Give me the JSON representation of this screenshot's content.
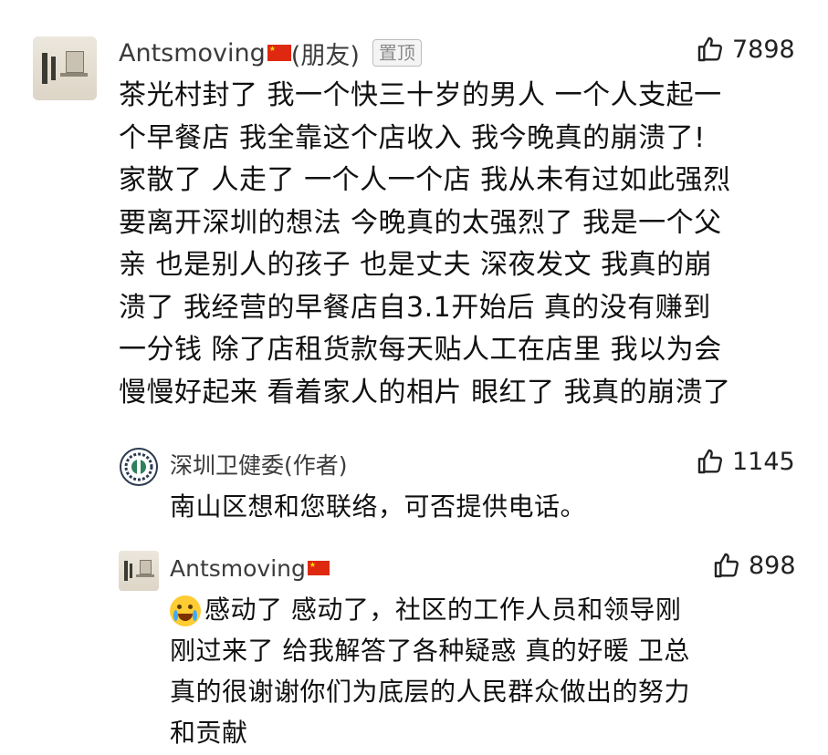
{
  "comments": [
    {
      "username": "Antsmoving",
      "relation": "(朋友)",
      "pinned_label": "置顶",
      "likes": "7898",
      "lines": [
        "茶光村封了 我一个快三十岁的男人 一个人支起一",
        "个早餐店 我全靠这个店收入 我今晚真的崩溃了!",
        "家散了 人走了 一个人一个店 我从未有过如此强烈",
        "要离开深圳的想法 今晚真的太强烈了 我是一个父",
        "亲  也是别人的孩子 也是丈夫  深夜发文 我真的崩",
        "溃了 我经营的早餐店自3.1开始后 真的没有赚到",
        "一分钱 除了店租货款每天贴人工在店里  我以为会",
        "慢慢好起来 看着家人的相片 眼红了 我真的崩溃了"
      ]
    },
    {
      "username": "深圳卫健委(作者)",
      "likes": "1145",
      "lines": [
        "南山区想和您联络，可否提供电话。"
      ]
    },
    {
      "username": "Antsmoving",
      "likes": "898",
      "lines": [
        "感动了 感动了，社区的工作人员和领导刚",
        "刚过来了 给我解答了各种疑惑 真的好暖 卫总",
        "真的很谢谢你们为底层的人民群众做出的努力",
        "和贡献"
      ]
    }
  ],
  "icons": {
    "flag": "china-flag-icon",
    "like": "thumbs-up-icon",
    "emoji": "crying-face-emoji-icon",
    "org_logo": "health-commission-logo-icon"
  },
  "colors": {
    "text": "#111111",
    "name": "#3b3b3b",
    "badge_border": "#bdbdbd",
    "flag": "#de2910"
  }
}
